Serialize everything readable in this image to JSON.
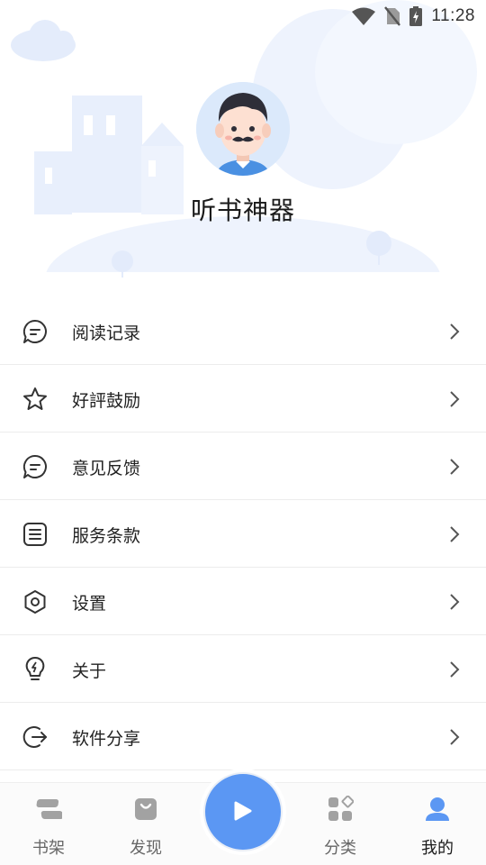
{
  "status_bar": {
    "time": "11:28",
    "icons": [
      "wifi-icon",
      "no-sim-icon",
      "battery-charging-icon"
    ]
  },
  "profile": {
    "app_name": "听书神器",
    "avatar_icon": "cartoon-man-avatar"
  },
  "menu": {
    "items": [
      {
        "label": "阅读记录",
        "icon": "chat-bubble-icon"
      },
      {
        "label": "好評鼓励",
        "icon": "star-icon"
      },
      {
        "label": "意见反馈",
        "icon": "chat-bubble-icon"
      },
      {
        "label": "服务条款",
        "icon": "document-icon"
      },
      {
        "label": "设置",
        "icon": "hexagon-settings-icon"
      },
      {
        "label": "关于",
        "icon": "lightbulb-icon"
      },
      {
        "label": "软件分享",
        "icon": "share-arrow-icon"
      }
    ]
  },
  "bottom_nav": {
    "items": [
      {
        "label": "书架",
        "icon": "bookshelf-icon",
        "active": false
      },
      {
        "label": "发现",
        "icon": "shopping-bag-icon",
        "active": false
      },
      {
        "label": "分类",
        "icon": "category-grid-icon",
        "active": false
      },
      {
        "label": "我的",
        "icon": "user-icon",
        "active": true
      }
    ],
    "play_icon": "play-icon"
  },
  "colors": {
    "accent": "#5b97f3",
    "nav_inactive": "#9a9a9a",
    "illustration": "#e6eefc"
  }
}
